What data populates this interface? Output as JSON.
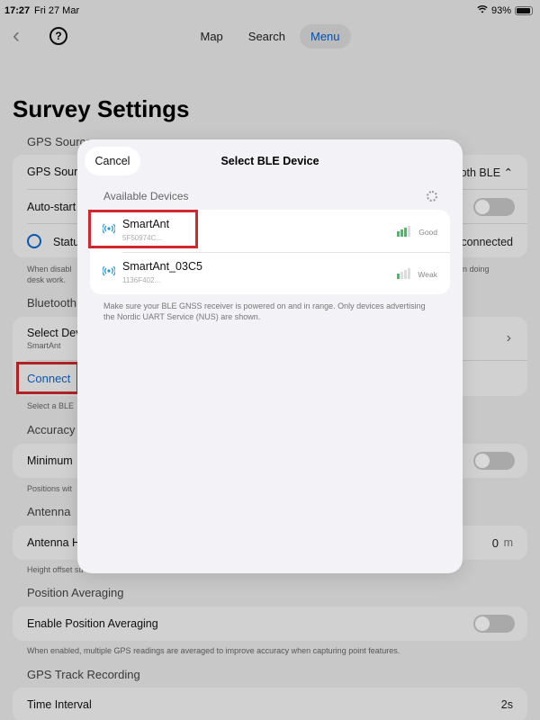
{
  "status_bar": {
    "time": "17:27",
    "date": "Fri 27 Mar",
    "battery": "93%",
    "battery_fraction": 0.93
  },
  "nav": {
    "tabs": [
      {
        "label": "Map"
      },
      {
        "label": "Search"
      },
      {
        "label": "Menu"
      }
    ],
    "help": "?"
  },
  "page": {
    "title": "Survey Settings",
    "gps_source": {
      "header": "GPS Source",
      "source_label": "GPS Sourc",
      "source_value": "oth BLE ⌃",
      "autostart_label": "Auto-start",
      "status_label": "Statu",
      "status_value": "connected",
      "footnote_left": "When disabl",
      "footnote_right": "n doing",
      "footnote_2": "desk work."
    },
    "bluetooth": {
      "header": "Bluetooth",
      "select_label": "Select Dev",
      "select_sub": "SmartAnt",
      "connect": "Connect",
      "footnote": "Select a BLE"
    },
    "accuracy": {
      "header": "Accuracy",
      "minimum_label": "Minimum",
      "footnote": "Positions wit"
    },
    "antenna": {
      "header": "Antenna",
      "height_label": "Antenna H",
      "height_value": "0",
      "height_unit": "m",
      "footnote": "Height offset su"
    },
    "position_averaging": {
      "header": "Position Averaging",
      "enable_label": "Enable Position Averaging",
      "footnote": "When enabled, multiple GPS readings are averaged to improve accuracy when capturing point features."
    },
    "track_recording": {
      "header": "GPS Track Recording",
      "interval_label": "Time Interval",
      "interval_value": "2s"
    }
  },
  "modal": {
    "cancel": "Cancel",
    "title": "Select BLE Device",
    "section": "Available Devices",
    "devices": [
      {
        "name": "SmartAnt",
        "id": "5F50974C...",
        "signal": "Good",
        "signal_color": "#34c759"
      },
      {
        "name": "SmartAnt_03C5",
        "id": "1136F402...",
        "signal": "Weak",
        "signal_color": "#34c759"
      }
    ],
    "note": "Make sure your BLE GNSS receiver is powered on and in range. Only devices advertising the Nordic UART Service (NUS) are shown."
  },
  "colors": {
    "accent": "#0a67d0",
    "highlight": "#d0282e"
  }
}
